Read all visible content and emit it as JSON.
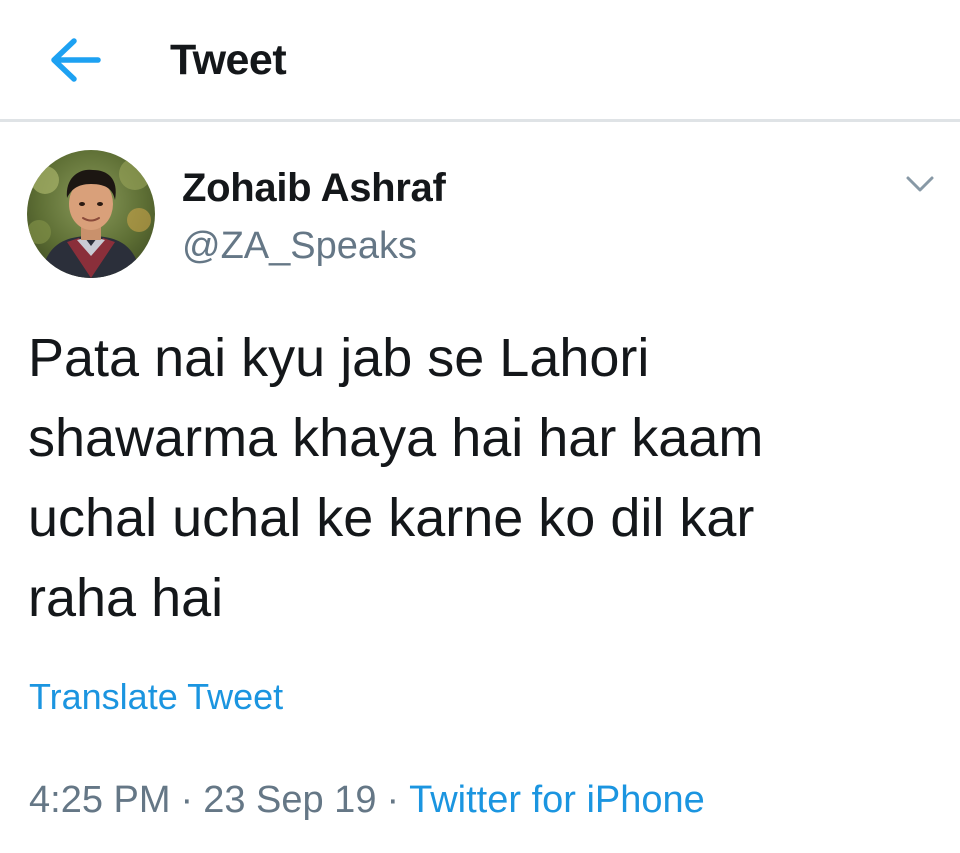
{
  "header": {
    "title": "Tweet",
    "back_icon": "arrow-left-icon",
    "accent_color": "#1da1f2"
  },
  "tweet": {
    "author": {
      "display_name": "Zohaib Ashraf",
      "handle": "@ZA_Speaks",
      "avatar_icon": "avatar"
    },
    "menu_icon": "chevron-down-icon",
    "text": "Pata nai kyu jab se Lahori\nshawarma khaya hai har kaam\nuchal uchal ke karne ko dil kar\nraha hai",
    "translate_label": "Translate Tweet",
    "time": "4:25 PM",
    "separator": "·",
    "date": "23 Sep 19",
    "source": "Twitter for iPhone"
  },
  "colors": {
    "link": "#1b95e0",
    "secondary_text": "#657786",
    "primary_text": "#14171a",
    "divider": "#dfe3e6"
  }
}
